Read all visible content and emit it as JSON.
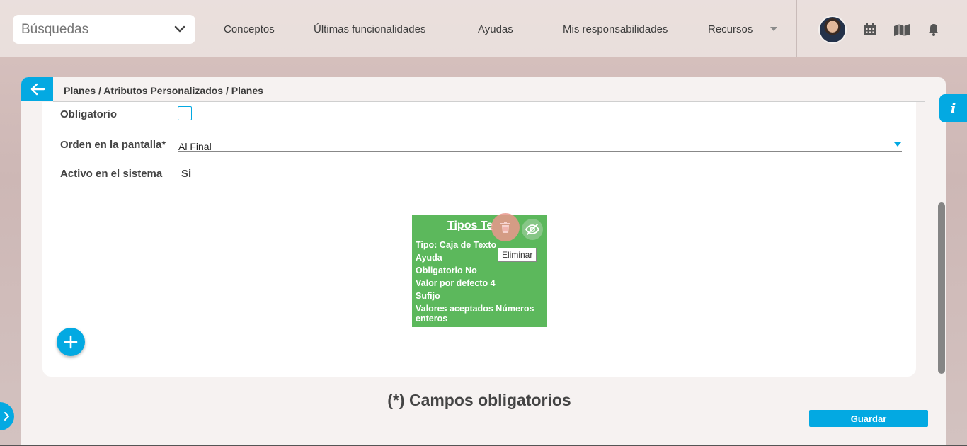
{
  "search": {
    "label": "Búsquedas"
  },
  "nav": {
    "items": [
      {
        "label": "Conceptos"
      },
      {
        "label": "Últimas funcionalidades"
      },
      {
        "label": "Ayudas"
      },
      {
        "label": "Mis responsabilidades"
      },
      {
        "label": "Recursos"
      }
    ]
  },
  "header": {
    "icons": [
      "calendar-icon",
      "map-icon",
      "bell-icon"
    ]
  },
  "breadcrumb": "Planes / Atributos Personalizados / Planes",
  "info_tab": "i",
  "form": {
    "obligatorio_label": "Obligatorio",
    "orden_label": "Orden en la pantalla*",
    "orden_value": "Al Final",
    "activo_label": "Activo en el sistema",
    "activo_value": "Si"
  },
  "attribute_card": {
    "title": "Tipos Te",
    "lines": [
      "Tipo: Caja de Texto",
      "Ayuda",
      "Obligatorio No",
      "Valor por defecto 4",
      "Sufijo",
      "Valores aceptados Números",
      "enteros"
    ],
    "tooltip": "Eliminar",
    "color": "#5cb85c"
  },
  "footer": {
    "required_note": "(*) Campos obligatorios",
    "save_label": "Guardar"
  },
  "colors": {
    "accent": "#03a9e2",
    "card_green": "#5cb85c"
  }
}
